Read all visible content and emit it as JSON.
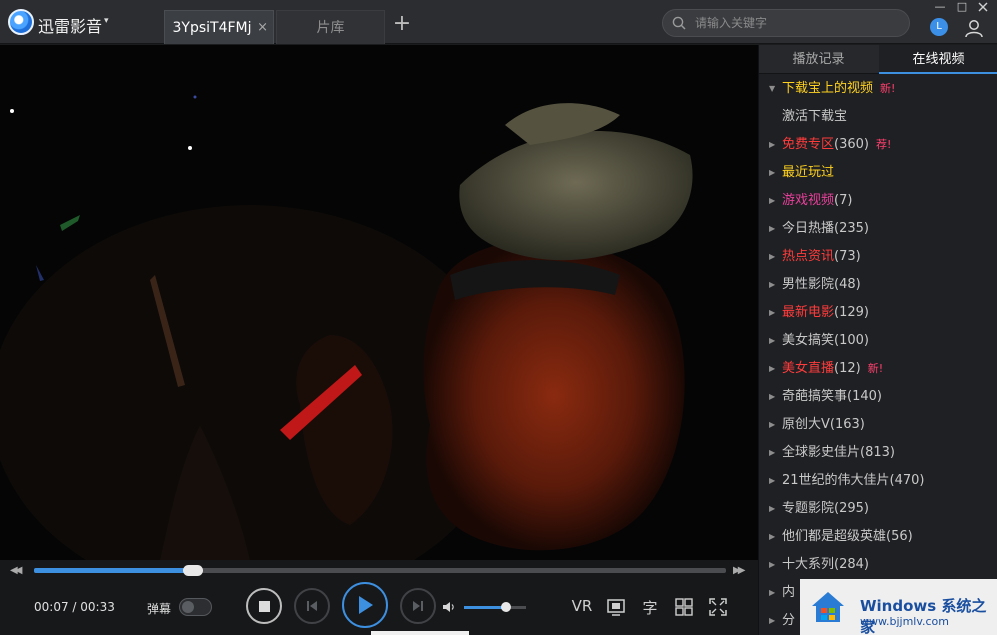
{
  "app": {
    "name": "迅雷影音",
    "caret": "▾",
    "icons": {
      "logo": "xunlei-logo-icon",
      "clock": "clock-icon",
      "user": "user-icon"
    }
  },
  "tabs": [
    {
      "label": "3YpsiT4FMj",
      "active": true,
      "close": "×"
    },
    {
      "label": "片库",
      "active": false
    }
  ],
  "new_tab": "+",
  "search": {
    "placeholder": "请输入关键字"
  },
  "clock_glyph": "L",
  "window_controls": {
    "minimize": "—",
    "maximize": "□"
  },
  "player": {
    "time_current": "00:07",
    "time_total": "00:33",
    "time_display": "00:07 / 00:33",
    "progress_fraction": 0.23,
    "volume_fraction": 0.68,
    "danmu_label": "弹幕",
    "danmu_on": false,
    "controls": {
      "vr": "VR",
      "subtitle": "字"
    }
  },
  "panel": {
    "tabs": [
      "播放记录",
      "在线视频"
    ],
    "active_tab": "在线视频",
    "items": [
      {
        "label": "下载宝上的视频",
        "count": "",
        "badge": "新!",
        "color": "#ffd21f",
        "expanded": true,
        "indent": false
      },
      {
        "label": "激活下载宝",
        "count": "",
        "badge": "",
        "color": "#c9c9c9",
        "expanded": null,
        "indent": true
      },
      {
        "label": "免费专区",
        "count": "(360)",
        "badge": "荐!",
        "color": "#ff3c3c",
        "expanded": false,
        "indent": false
      },
      {
        "label": "最近玩过",
        "count": "",
        "badge": "",
        "color": "#ffd21f",
        "expanded": false,
        "indent": false
      },
      {
        "label": "游戏视频",
        "count": "(7)",
        "badge": "",
        "color": "#e9409c",
        "expanded": false,
        "indent": false
      },
      {
        "label": "今日热播",
        "count": "(235)",
        "badge": "",
        "color": "#c9c9c9",
        "expanded": false,
        "indent": false
      },
      {
        "label": "热点资讯",
        "count": "(73)",
        "badge": "",
        "color": "#ff3c3c",
        "expanded": false,
        "indent": false
      },
      {
        "label": "男性影院",
        "count": "(48)",
        "badge": "",
        "color": "#c9c9c9",
        "expanded": false,
        "indent": false
      },
      {
        "label": "最新电影",
        "count": "(129)",
        "badge": "",
        "color": "#ff3c3c",
        "expanded": false,
        "indent": false
      },
      {
        "label": "美女搞笑",
        "count": "(100)",
        "badge": "",
        "color": "#c9c9c9",
        "expanded": false,
        "indent": false
      },
      {
        "label": "美女直播",
        "count": "(12)",
        "badge": "新!",
        "color": "#ff3c3c",
        "expanded": false,
        "indent": false
      },
      {
        "label": "奇葩搞笑事",
        "count": "(140)",
        "badge": "",
        "color": "#c9c9c9",
        "expanded": false,
        "indent": false
      },
      {
        "label": "原创大V",
        "count": "(163)",
        "badge": "",
        "color": "#c9c9c9",
        "expanded": false,
        "indent": false
      },
      {
        "label": "全球影史佳片",
        "count": "(813)",
        "badge": "",
        "color": "#c9c9c9",
        "expanded": false,
        "indent": false
      },
      {
        "label": "21世纪的伟大佳片",
        "count": "(470)",
        "badge": "",
        "color": "#c9c9c9",
        "expanded": false,
        "indent": false
      },
      {
        "label": "专题影院",
        "count": "(295)",
        "badge": "",
        "color": "#c9c9c9",
        "expanded": false,
        "indent": false
      },
      {
        "label": "他们都是超级英雄",
        "count": "(56)",
        "badge": "",
        "color": "#c9c9c9",
        "expanded": false,
        "indent": false
      },
      {
        "label": "十大系列",
        "count": "(284)",
        "badge": "",
        "color": "#c9c9c9",
        "expanded": false,
        "indent": false
      },
      {
        "label": "内",
        "count": "",
        "badge": "",
        "color": "#c9c9c9",
        "expanded": false,
        "indent": false
      },
      {
        "label": "分",
        "count": "",
        "badge": "",
        "color": "#c9c9c9",
        "expanded": false,
        "indent": false
      }
    ]
  },
  "watermark": {
    "title": "Windows 系统之家",
    "url": "www.bjjmlv.com"
  }
}
